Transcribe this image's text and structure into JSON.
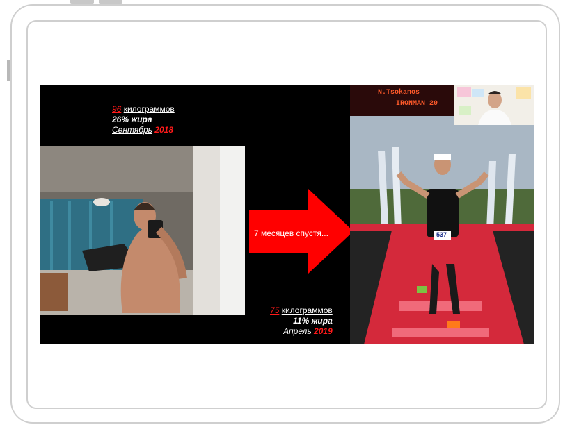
{
  "before": {
    "weight_value": "96",
    "weight_unit": "килограммов",
    "fat": "26% жира",
    "month": "Сентябрь",
    "year": "2018"
  },
  "arrow_label": "7 месяцев спустя...",
  "after": {
    "weight_value": "75",
    "weight_unit": "килограммов",
    "fat": "11% жира",
    "month": "Апрель",
    "year": "2019"
  },
  "scoreboard": {
    "name": "N.Tsokanos",
    "event": "IRONMAN 20"
  },
  "race_bib": "537",
  "colors": {
    "accent_red": "#ff1a1a",
    "slide_bg": "#000000"
  }
}
